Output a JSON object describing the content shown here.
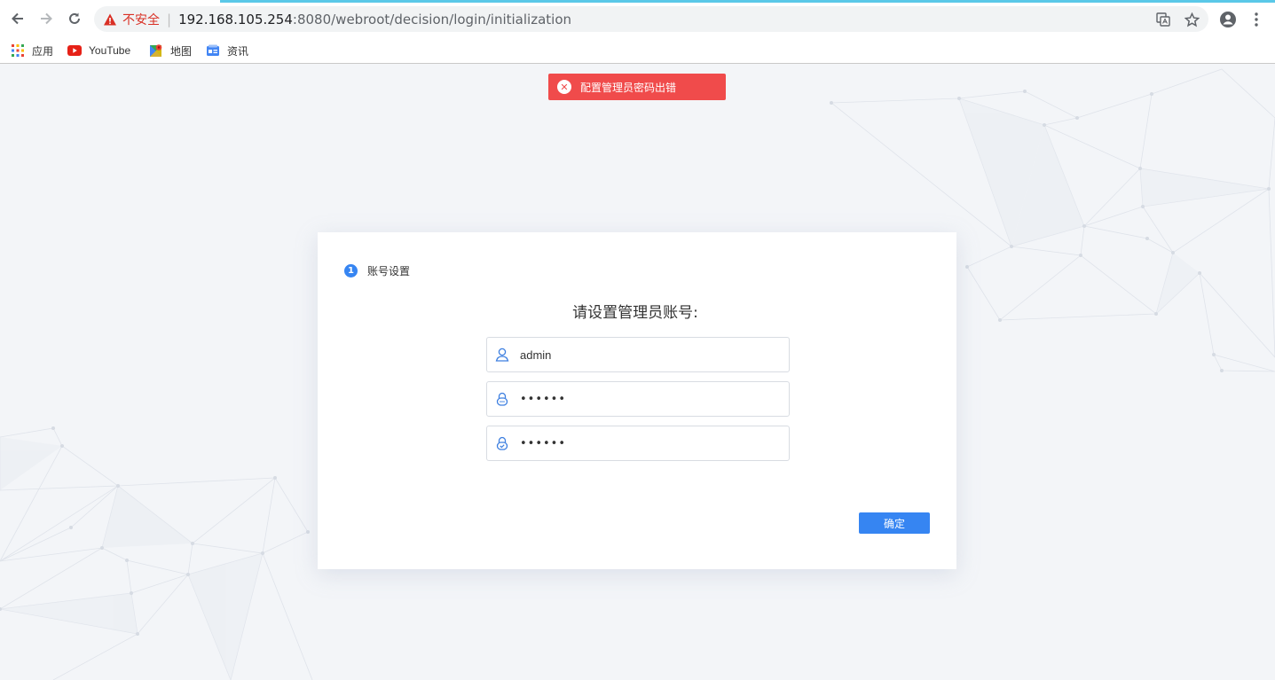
{
  "browser": {
    "security_label": "不安全",
    "url_host": "192.168.105.254",
    "url_rest": ":8080/webroot/decision/login/initialization",
    "bookmarks": [
      {
        "label": "应用"
      },
      {
        "label": "YouTube"
      },
      {
        "label": "地图"
      },
      {
        "label": "资讯"
      }
    ]
  },
  "toast": {
    "message": "配置管理员密码出错",
    "color": "#f04b4b"
  },
  "card": {
    "step_number": "1",
    "step_label": "账号设置",
    "heading": "请设置管理员账号:",
    "username_value": "admin",
    "password_mask": "••••••",
    "confirm_mask": "••••••",
    "confirm_button": "确定",
    "accent": "#3685f2"
  }
}
